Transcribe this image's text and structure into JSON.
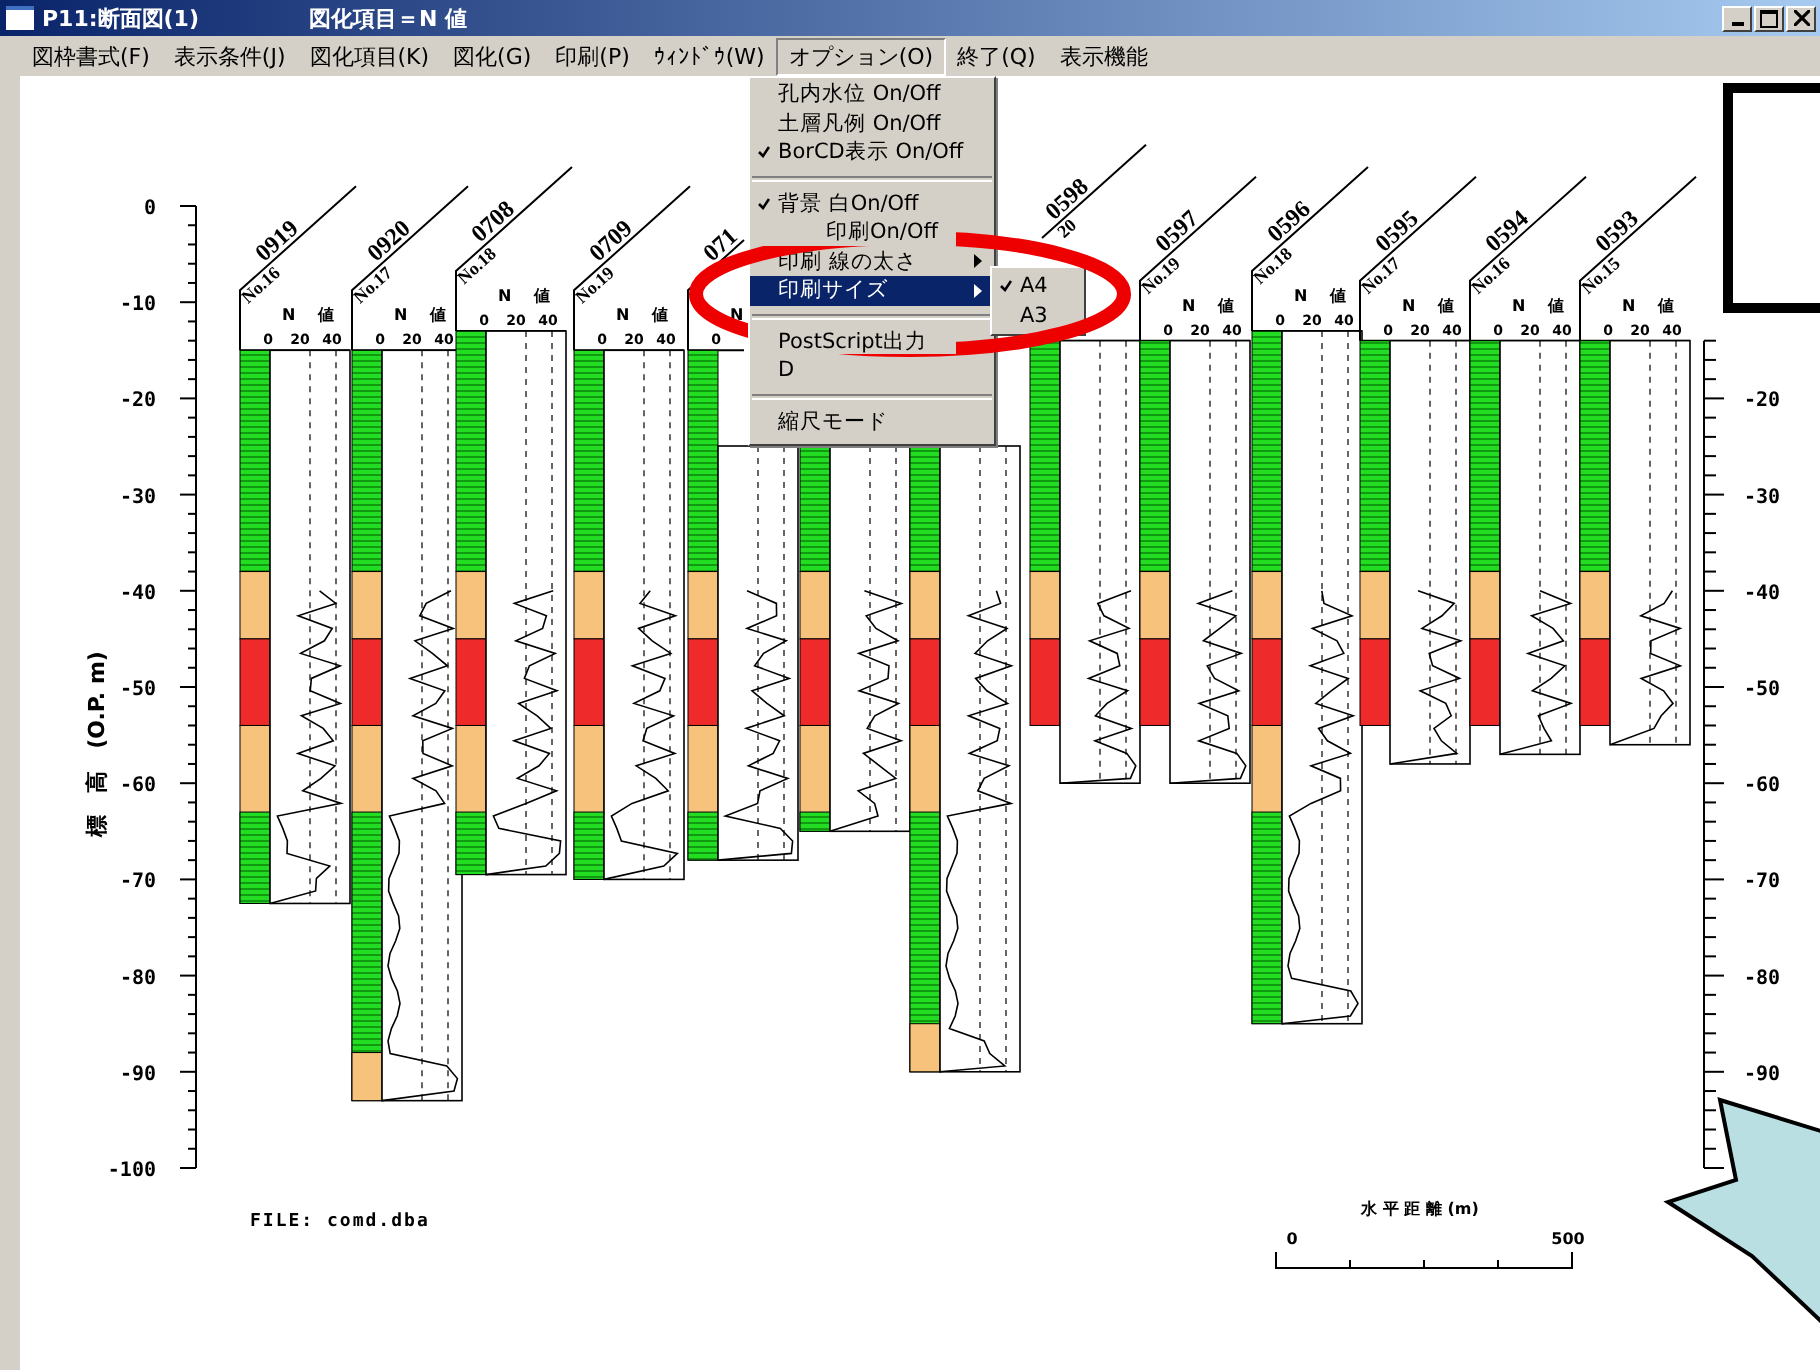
{
  "window": {
    "title": "P11:断面図(1)",
    "subtitle": "図化項目＝N 値"
  },
  "menu_bar": [
    {
      "label": "図枠書式(F)",
      "selected": false
    },
    {
      "label": "表示条件(J)",
      "selected": false
    },
    {
      "label": "図化項目(K)",
      "selected": false
    },
    {
      "label": "図化(G)",
      "selected": false
    },
    {
      "label": "印刷(P)",
      "selected": false
    },
    {
      "label": "ｳｨﾝﾄﾞｳ(W)",
      "selected": false
    },
    {
      "label": "オプション(O)",
      "selected": true
    },
    {
      "label": "終了(Q)",
      "selected": false
    },
    {
      "label": "表示機能",
      "selected": false
    }
  ],
  "dropdown": [
    {
      "kind": "item",
      "label": "孔内水位 On/Off",
      "checked": false,
      "selected": false
    },
    {
      "kind": "item",
      "label": "土層凡例 On/Off",
      "checked": false,
      "selected": false
    },
    {
      "kind": "item",
      "label": "BorCD表示 On/Off",
      "checked": true,
      "selected": false
    },
    {
      "kind": "separator"
    },
    {
      "kind": "item",
      "label": "背景 白On/Off",
      "checked": true,
      "selected": false
    },
    {
      "kind": "item",
      "label": "印刷On/Off",
      "checked": false,
      "selected": false
    },
    {
      "kind": "submenu",
      "label": "印刷 線の太さ",
      "checked": false,
      "selected": false
    },
    {
      "kind": "submenu",
      "label": "印刷サイズ",
      "checked": false,
      "selected": true
    },
    {
      "kind": "separator"
    },
    {
      "kind": "item",
      "label": "PostScript出力",
      "checked": false,
      "selected": false
    },
    {
      "kind": "item",
      "label": "D",
      "checked": false,
      "selected": false
    },
    {
      "kind": "separator"
    },
    {
      "kind": "item",
      "label": "縮尺モード",
      "checked": false,
      "selected": false
    }
  ],
  "submenu": [
    {
      "label": "A4",
      "checked": true
    },
    {
      "label": "A3",
      "checked": false
    }
  ],
  "section": {
    "y_axis_title": "標　高　(O.P. m)",
    "left_ticks": [
      "0",
      "-10",
      "-20",
      "-30",
      "-40",
      "-50",
      "-60",
      "-70",
      "-80",
      "-90",
      "-100"
    ],
    "right_ticks": [
      "-20",
      "-30",
      "-40",
      "-50",
      "-60",
      "-70",
      "-80",
      "-90"
    ],
    "boreholes": [
      {
        "name": "0919",
        "number": "No.16",
        "n_label": "N",
        "n_unit": "値",
        "scale": [
          "0",
          "20",
          "40"
        ]
      },
      {
        "name": "0920",
        "number": "No.17",
        "n_label": "N",
        "n_unit": "値",
        "scale": [
          "0",
          "20",
          "40"
        ]
      },
      {
        "name": "0708",
        "number": "No.18",
        "n_label": "N",
        "n_unit": "値",
        "scale": [
          "0",
          "20",
          "40"
        ]
      },
      {
        "name": "0709",
        "number": "No.19",
        "n_label": "N",
        "n_unit": "値",
        "scale": [
          "0",
          "20",
          "40"
        ]
      },
      {
        "name": "071",
        "n_label": "N",
        "scale": [
          "0"
        ]
      },
      {
        "name": "0598",
        "number": "20"
      },
      {
        "name": "0597",
        "number": "No.19",
        "n_label": "N",
        "n_unit": "値",
        "scale": [
          "0",
          "20",
          "40"
        ]
      },
      {
        "name": "0596",
        "number": "No.18",
        "n_label": "N",
        "n_unit": "値",
        "scale": [
          "0",
          "20",
          "40"
        ]
      },
      {
        "name": "0595",
        "number": "No.17",
        "n_label": "N",
        "n_unit": "値",
        "scale": [
          "0",
          "20",
          "40"
        ]
      },
      {
        "name": "0594",
        "number": "No.16",
        "n_label": "N",
        "n_unit": "値",
        "scale": [
          "0",
          "20",
          "40"
        ]
      },
      {
        "name": "0593",
        "number": "No.15",
        "n_label": "N",
        "n_unit": "値",
        "scale": [
          "0",
          "20",
          "40"
        ]
      }
    ],
    "file_label": "FILE: comd.dba",
    "scale_bar": {
      "title": "水 平 距 離 (m)",
      "start": "0",
      "end": "500"
    }
  }
}
